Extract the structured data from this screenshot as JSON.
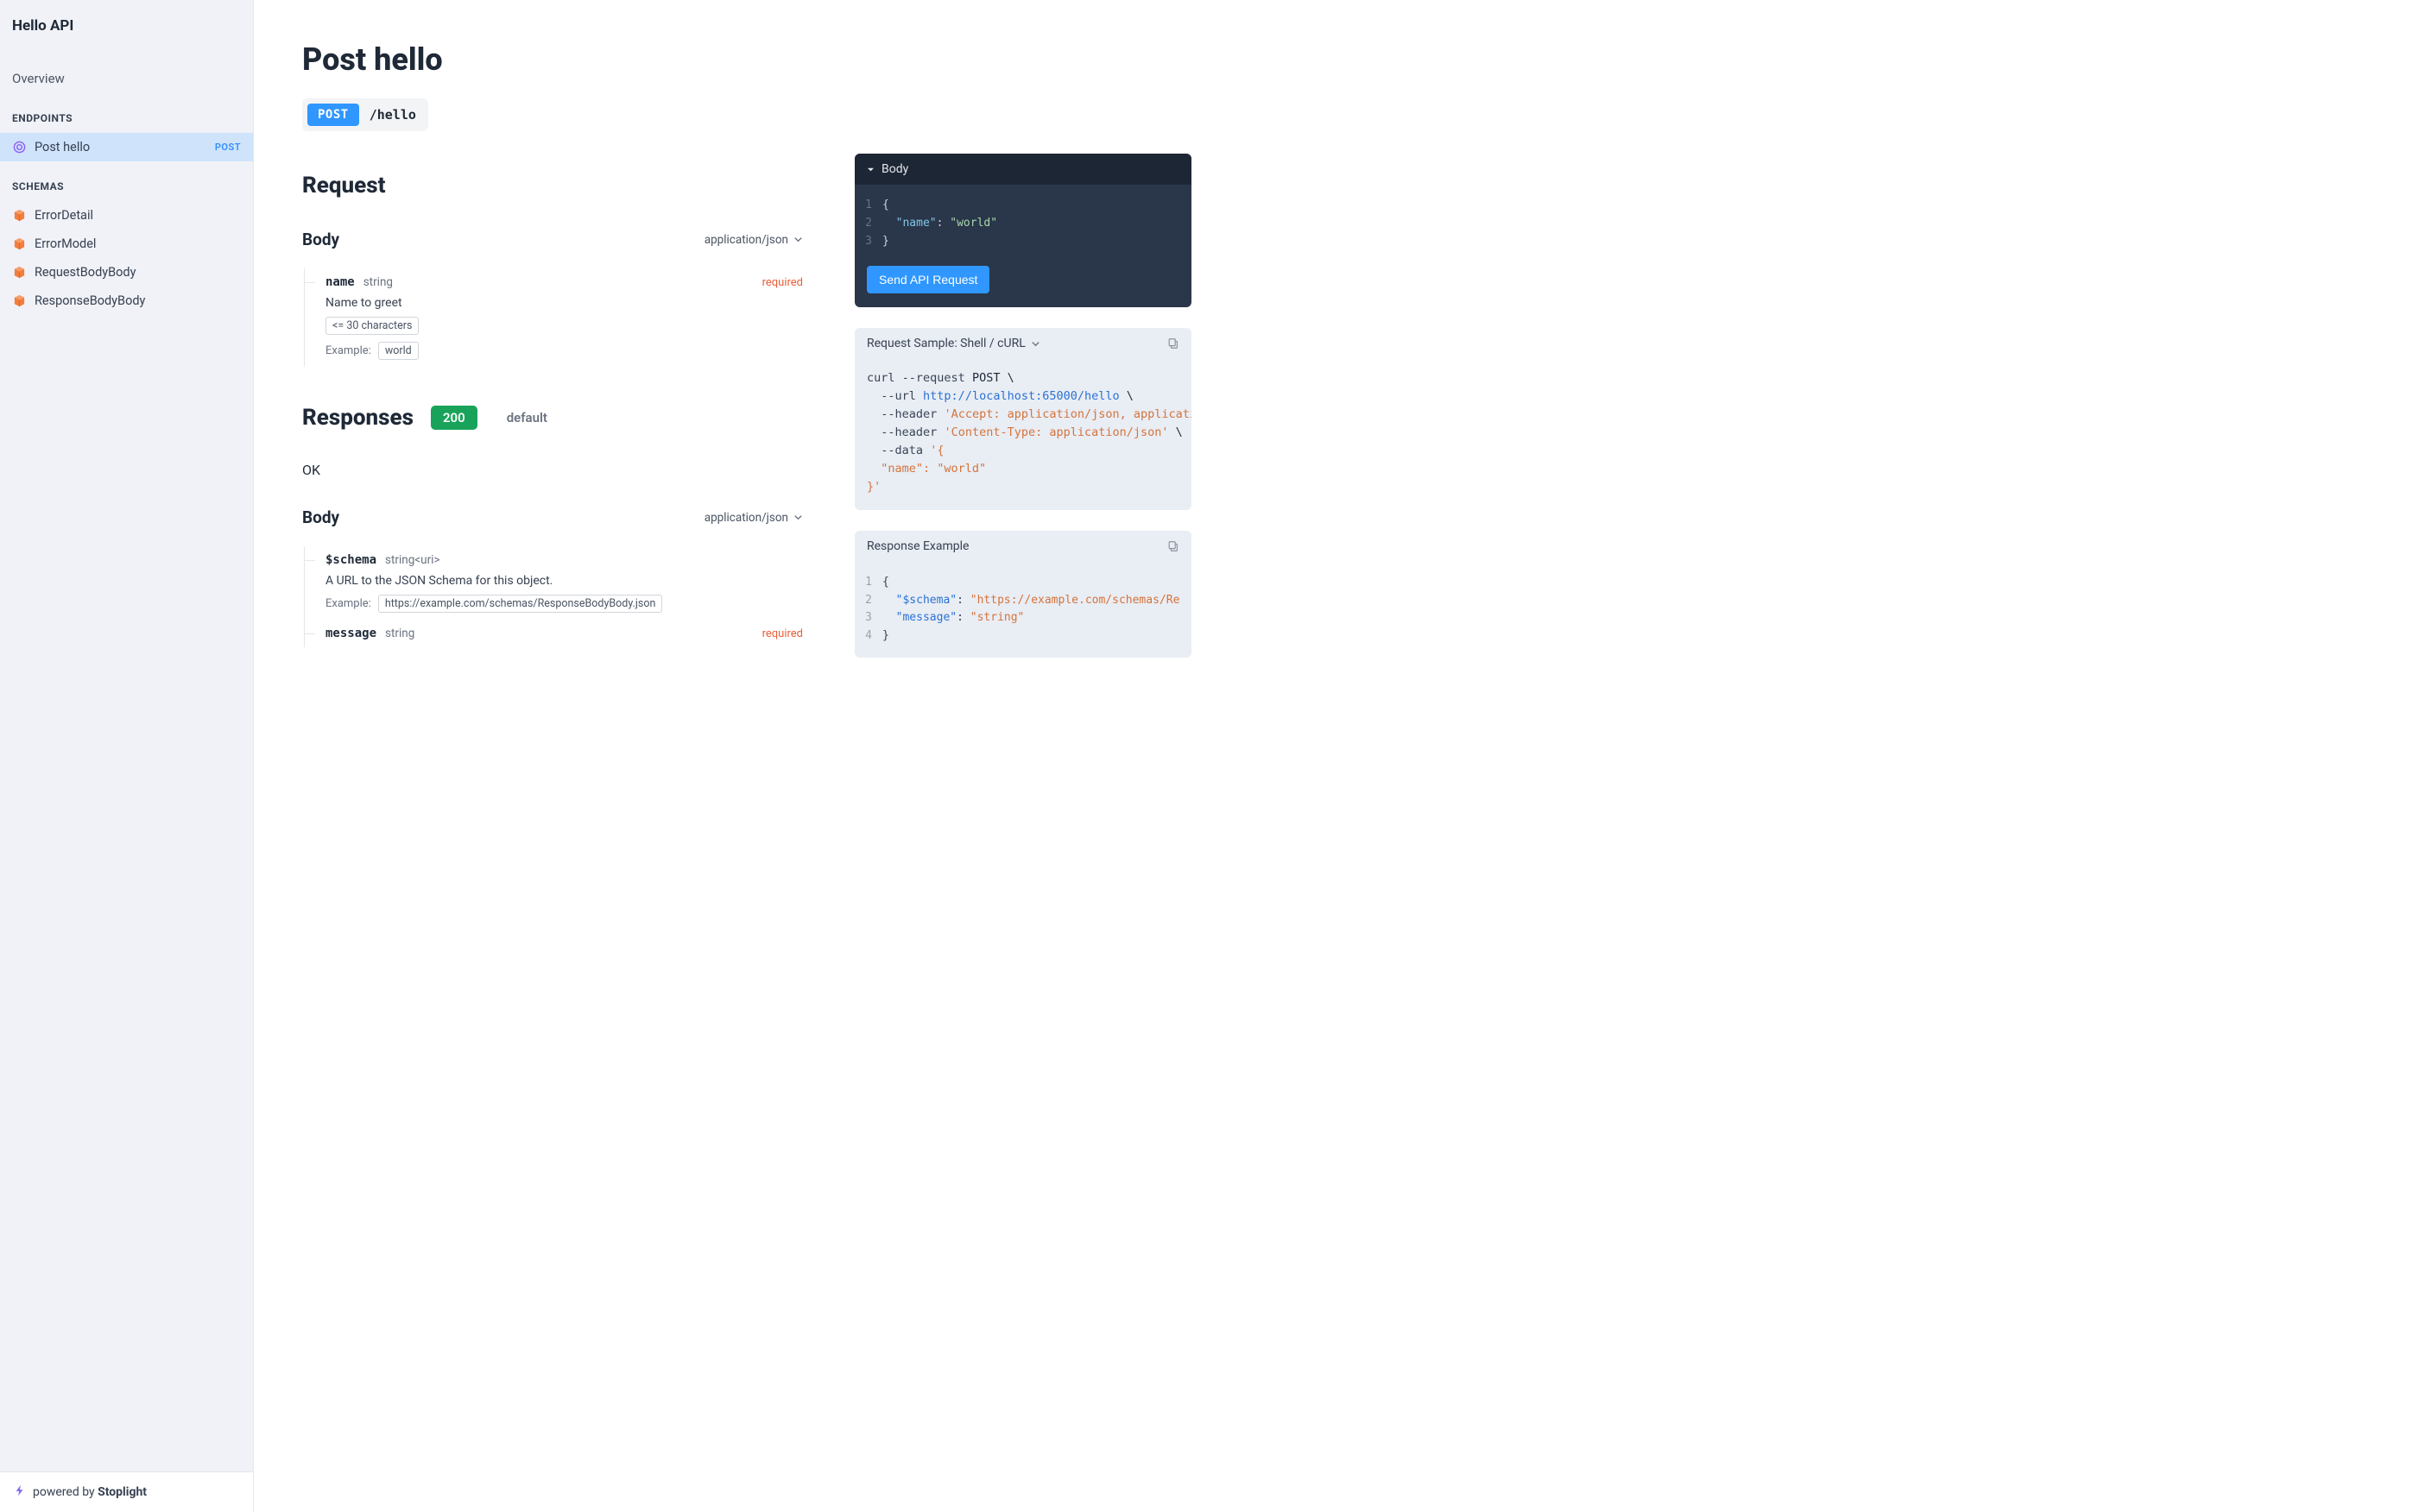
{
  "sidebar": {
    "title": "Hello API",
    "overview": "Overview",
    "endpoints_label": "ENDPOINTS",
    "endpoints": [
      {
        "label": "Post hello",
        "method": "POST",
        "active": true
      }
    ],
    "schemas_label": "SCHEMAS",
    "schemas": [
      {
        "label": "ErrorDetail"
      },
      {
        "label": "ErrorModel"
      },
      {
        "label": "RequestBodyBody"
      },
      {
        "label": "ResponseBodyBody"
      }
    ],
    "footer_prefix": "powered by ",
    "footer_brand": "Stoplight"
  },
  "page": {
    "title": "Post hello",
    "method": "POST",
    "path": "/hello"
  },
  "request": {
    "heading": "Request",
    "body_label": "Body",
    "content_type": "application/json",
    "fields": [
      {
        "name": "name",
        "type": "string",
        "required": "required",
        "description": "Name to greet",
        "constraint": "<= 30 characters",
        "example_label": "Example:",
        "example": "world"
      }
    ]
  },
  "responses": {
    "heading": "Responses",
    "tabs": [
      {
        "label": "200",
        "active": true
      },
      {
        "label": "default",
        "active": false
      }
    ],
    "status_text": "OK",
    "body_label": "Body",
    "content_type": "application/json",
    "fields": [
      {
        "name": "$schema",
        "type": "string<uri>",
        "required": "",
        "description": "A URL to the JSON Schema for this object.",
        "example_label": "Example:",
        "example": "https://example.com/schemas/ResponseBodyBody.json"
      },
      {
        "name": "message",
        "type": "string",
        "required": "required"
      }
    ]
  },
  "tryit": {
    "body_label": "Body",
    "json_lines": [
      "{",
      "  \"name\": \"world\"",
      "}"
    ],
    "send_button": "Send API Request"
  },
  "sample": {
    "label": "Request Sample: Shell / cURL",
    "curl": "curl --request POST \\\n  --url http://localhost:65000/hello \\\n  --header 'Accept: application/json, applicati\n  --header 'Content-Type: application/json' \\\n  --data '{\n  \"name\": \"world\"\n}'"
  },
  "response_example": {
    "label": "Response Example",
    "lines": [
      "{",
      "  \"$schema\": \"https://example.com/schemas/Re",
      "  \"message\": \"string\"",
      "}"
    ]
  }
}
